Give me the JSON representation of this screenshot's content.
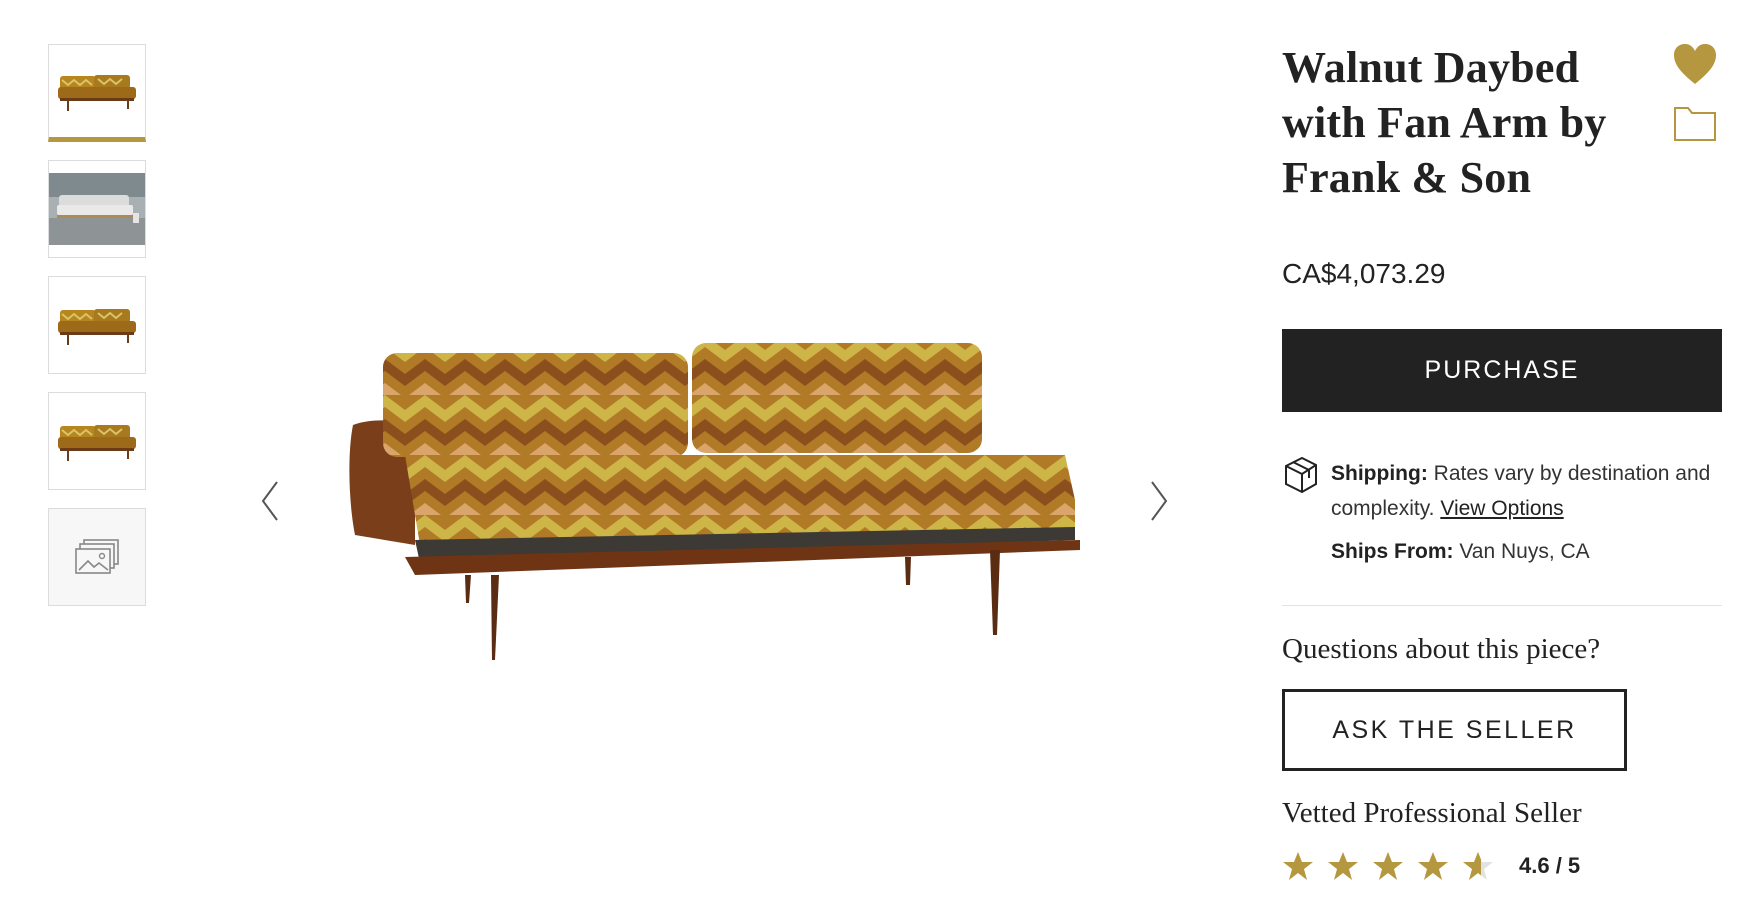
{
  "product": {
    "title": "Walnut Daybed with Fan Arm by Frank & Son",
    "price": "CA$4,073.29"
  },
  "actions": {
    "purchase_label": "PURCHASE",
    "ask_label": "ASK THE SELLER"
  },
  "shipping": {
    "label": "Shipping:",
    "text": "Rates vary by destination and complexity.",
    "link": "View Options",
    "from_label": "Ships From:",
    "from_value": "Van Nuys, CA"
  },
  "questions": "Questions about this piece?",
  "seller": {
    "label": "Vetted Professional Seller",
    "rating_text": "4.6 / 5",
    "rating": 4.6,
    "max_rating": 5
  },
  "gallery": {
    "active_index": 0,
    "thumbs": [
      "daybed-front",
      "daybed-showroom",
      "daybed-front",
      "daybed-front",
      "more-images-icon"
    ]
  },
  "colors": {
    "accent": "#b5973f",
    "dark": "#222222"
  }
}
